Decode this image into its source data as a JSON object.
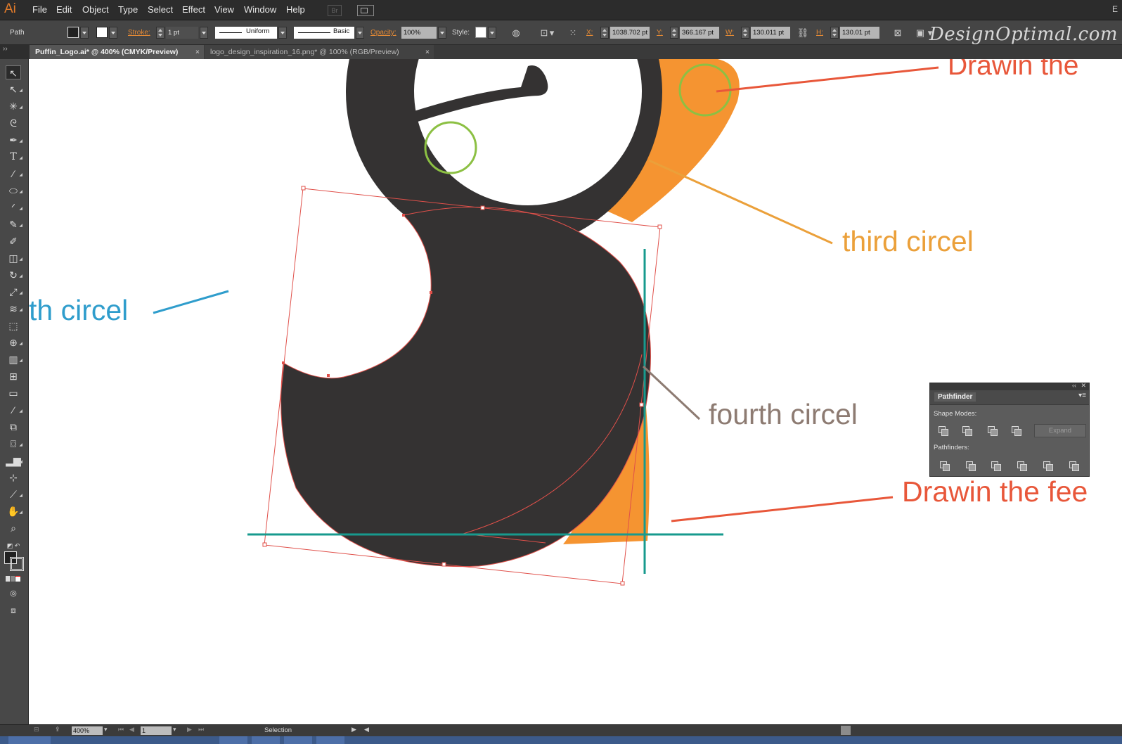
{
  "app": {
    "logo": "Ai"
  },
  "menu": [
    "File",
    "Edit",
    "Object",
    "Type",
    "Select",
    "Effect",
    "View",
    "Window",
    "Help"
  ],
  "menubar_extra": {
    "bridge": "Br",
    "right_label": "E"
  },
  "control_bar": {
    "object_type": "Path",
    "stroke_label": "Stroke:",
    "stroke_weight": "1 pt",
    "stroke_profile": "Uniform",
    "brush": "Basic",
    "opacity_label": "Opacity:",
    "opacity": "100%",
    "style_label": "Style:",
    "x_label": "X:",
    "x": "1038.702 pt",
    "y_label": "Y:",
    "y": "366.167 pt",
    "w_label": "W:",
    "w": "130.011 pt",
    "h_label": "H:",
    "h": "130.01 pt"
  },
  "watermark": "DesignOptimal.com",
  "tabs": [
    {
      "label": "Puffin_Logo.ai* @ 400% (CMYK/Preview)",
      "active": true,
      "close": "×"
    },
    {
      "label": "logo_design_inspiration_16.png* @ 100% (RGB/Preview)",
      "active": false,
      "close": "×"
    }
  ],
  "annotations": {
    "drawin_top": "Drawin the",
    "third_circle": "third  circel",
    "fourth_circle": "fourth circel",
    "drawin_feet": "Drawin the fee",
    "nth_circle": "th circel"
  },
  "pathfinder": {
    "title": "Pathfinder",
    "shape_modes_label": "Shape Modes:",
    "expand_label": "Expand",
    "pathfinders_label": "Pathfinders:",
    "panel_collapse": "‹‹",
    "panel_close": "✕",
    "panel_menu": "▾≡"
  },
  "status_bar": {
    "zoom": "400%",
    "page": "1",
    "tool": "Selection"
  },
  "colors": {
    "body_dark": "#343232",
    "beak_orange": "#f59431",
    "guide_teal": "#179a8e",
    "selection_red": "#e0504a",
    "green_circle": "#8cc043",
    "annotation_red": "#e8573a",
    "annotation_orange": "#eba03a",
    "annotation_taupe": "#8d7b72",
    "annotation_blue": "#2f9dcc"
  }
}
